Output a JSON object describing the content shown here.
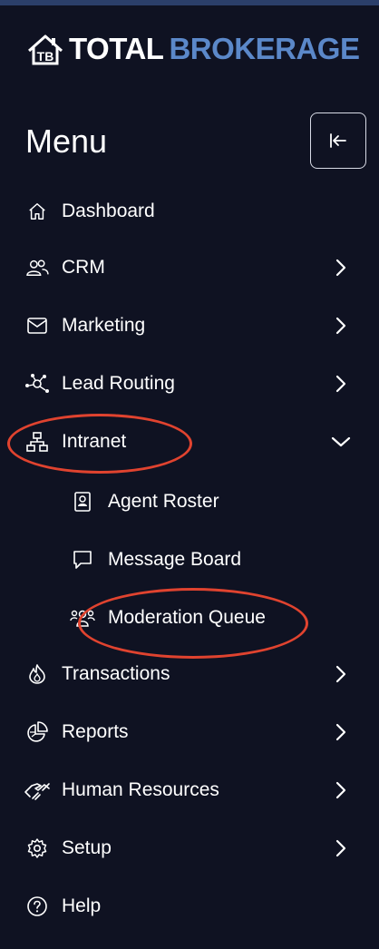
{
  "brand": {
    "logo_initials": "TB",
    "logo_word1": "TOTAL",
    "logo_word2": "BROKERAGE"
  },
  "menu": {
    "title": "Menu",
    "collapse_icon": "collapse-left-icon"
  },
  "nav": [
    {
      "label": "Dashboard",
      "icon": "home-icon",
      "chevron": "none"
    },
    {
      "label": "CRM",
      "icon": "users-icon",
      "chevron": "right"
    },
    {
      "label": "Marketing",
      "icon": "mail-icon",
      "chevron": "right"
    },
    {
      "label": "Lead Routing",
      "icon": "network-icon",
      "chevron": "right"
    },
    {
      "label": "Intranet",
      "icon": "sitemap-icon",
      "chevron": "down",
      "expanded": true,
      "children": [
        {
          "label": "Agent Roster",
          "icon": "id-card-icon"
        },
        {
          "label": "Message Board",
          "icon": "chat-bubble-icon"
        },
        {
          "label": "Moderation Queue",
          "icon": "group-icon"
        }
      ]
    },
    {
      "label": "Transactions",
      "icon": "flame-icon",
      "chevron": "right"
    },
    {
      "label": "Reports",
      "icon": "pie-chart-icon",
      "chevron": "right"
    },
    {
      "label": "Human Resources",
      "icon": "handshake-icon",
      "chevron": "right"
    },
    {
      "label": "Setup",
      "icon": "gear-icon",
      "chevron": "right"
    },
    {
      "label": "Help",
      "icon": "help-circle-icon",
      "chevron": "none"
    }
  ],
  "colors": {
    "background": "#0f1222",
    "brand_blue": "#5b88c9",
    "annotation_red": "#e0432f",
    "text": "#ffffff"
  }
}
